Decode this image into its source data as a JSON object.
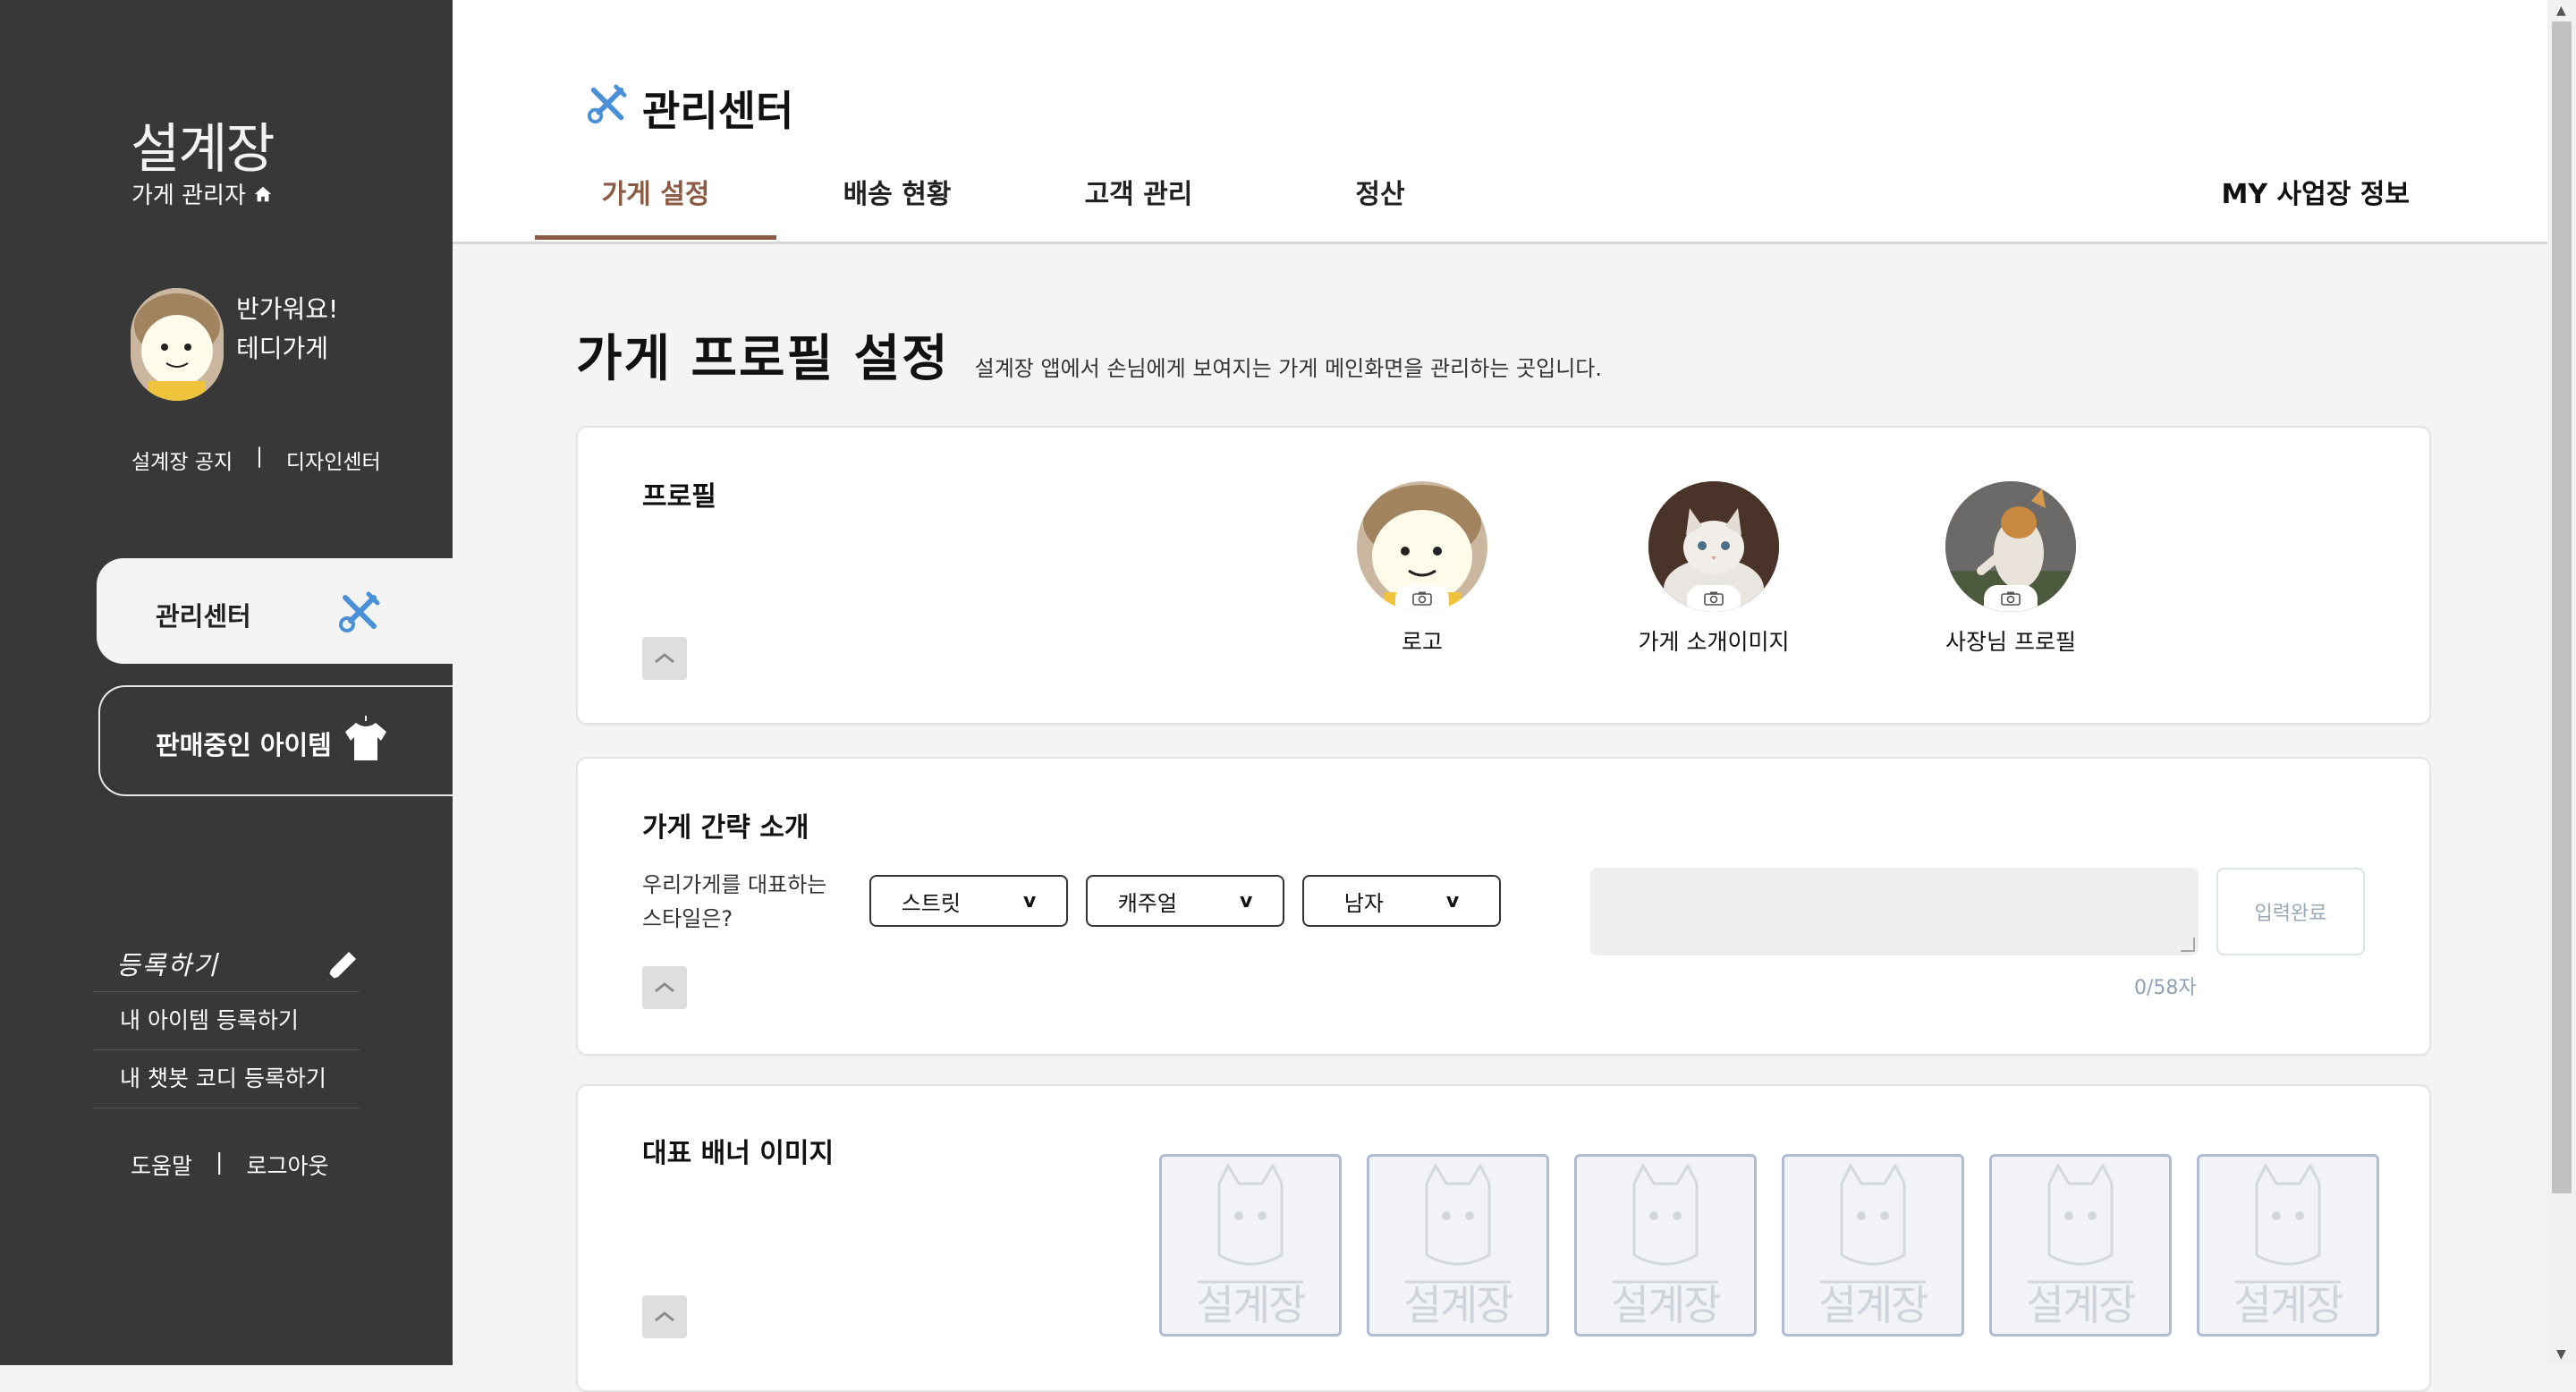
{
  "sidebar": {
    "brand": "설계장",
    "brand_sub": "가게 관리자",
    "greeting_line1": "반가워요!",
    "greeting_line2": "테디가게",
    "notice_link": "설계장 공지",
    "separator": "|",
    "design_center_link": "디자인센터",
    "menu": [
      {
        "label": "관리센터",
        "icon": "wrench-screwdriver-icon",
        "active": true
      },
      {
        "label": "판매중인 아이템",
        "icon": "tshirt-icon",
        "active": false
      }
    ],
    "register_title": "등록하기",
    "register_items": [
      "내 아이템 등록하기",
      "내 챗봇 코디 등록하기"
    ],
    "help_link": "도움말",
    "logout_link": "로그아웃"
  },
  "header": {
    "title": "관리센터",
    "tabs": [
      "가게 설정",
      "배송 현황",
      "고객 관리",
      "정산"
    ],
    "active_tab": 0,
    "my_info": "MY 사업장 정보"
  },
  "page": {
    "title": "가게 프로필 설정",
    "description": "설계장 앱에서 손님에게 보여지는 가게 메인화면을 관리하는 곳입니다."
  },
  "profile_card": {
    "title": "프로필",
    "items": [
      {
        "label": "로고",
        "image": "teddy-cartoon-logo"
      },
      {
        "label": "가게 소개이미지",
        "image": "kitten-photo"
      },
      {
        "label": "사장님 프로필",
        "image": "cat-photo"
      }
    ]
  },
  "intro_card": {
    "title": "가게 간략 소개",
    "style_question_line1": "우리가게를 대표하는",
    "style_question_line2": "스타일은?",
    "selects": [
      "스트릿",
      "캐주얼",
      "남자"
    ],
    "textarea_value": "",
    "counter": "0/58자",
    "submit_label": "입력완료"
  },
  "banner_card": {
    "title": "대표 배너 이미지",
    "slot_count": 6,
    "slot_watermark": "설계장"
  },
  "colors": {
    "sidebar_bg": "#383838",
    "accent_brown": "#8b5a45",
    "accent_blue": "#4a90d9",
    "page_bg": "#f4f4f4"
  }
}
